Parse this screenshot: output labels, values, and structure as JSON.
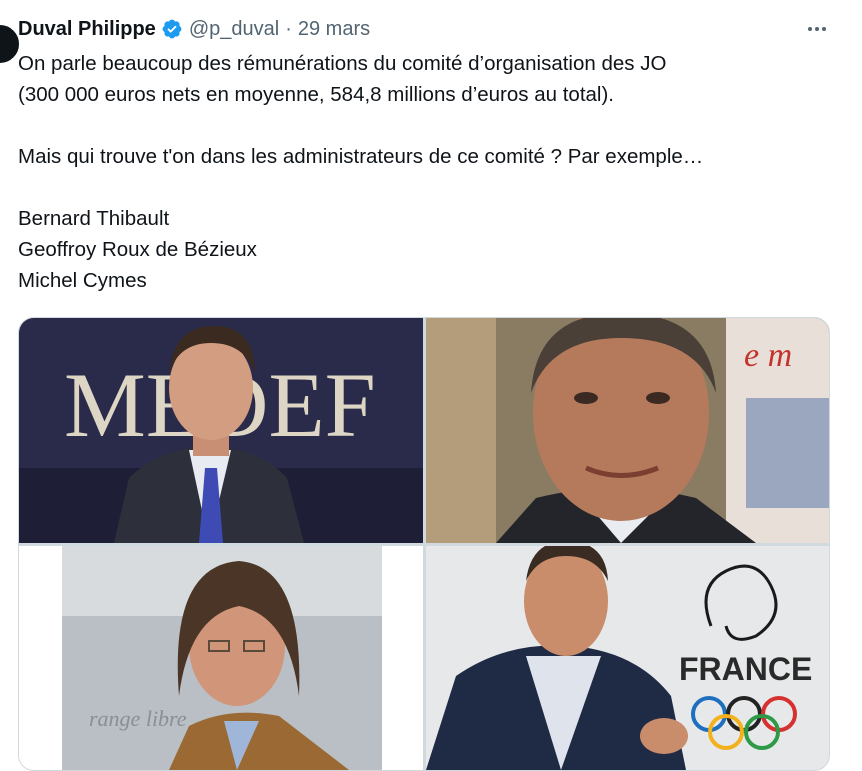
{
  "author": {
    "name": "Duval Philippe",
    "handle": "@p_duval",
    "separator": "·",
    "date": "29 mars"
  },
  "tweet": {
    "lines_1": [
      "On parle beaucoup des rémunérations du comité d’organisation des JO",
      "(300 000 euros nets en moyenne, 584,8 millions d’euros au total)."
    ],
    "line_2": "Mais qui trouve t'on dans les administrateurs de ce comité ? Par exemple…",
    "names": [
      "Bernard Thibault",
      "Geoffroy Roux de Bézieux",
      "Michel Cymes"
    ]
  },
  "media": {
    "photo1_text": "MEDEF",
    "photo2_text": "e m",
    "photo3_text": "range libre",
    "photo4_text": "FRANCE"
  },
  "colors": {
    "verified_blue": "#1d9bf0",
    "secondary_text": "#536471",
    "border": "#cfd9de"
  },
  "icons": {
    "verified": "verified-badge-icon",
    "more": "more-horizontal-icon"
  }
}
